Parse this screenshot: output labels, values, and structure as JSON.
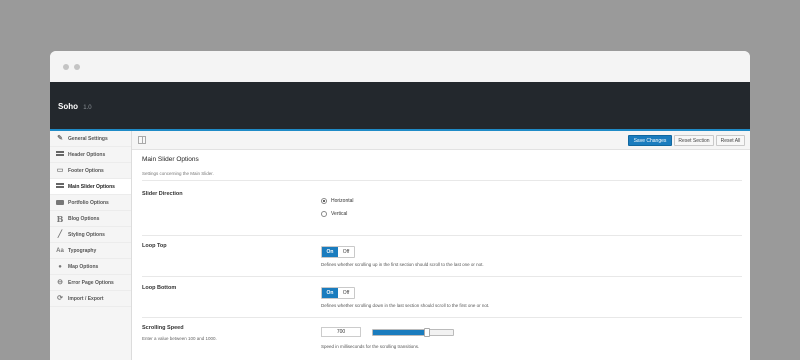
{
  "app": {
    "title": "Soho",
    "version": "1.0"
  },
  "sidebar": {
    "items": [
      {
        "label": "General Settings",
        "icon": "wrench-icon"
      },
      {
        "label": "Header Options",
        "icon": "header-icon"
      },
      {
        "label": "Footer Options",
        "icon": "footer-icon"
      },
      {
        "label": "Main Slider Options",
        "icon": "slider-icon",
        "active": true
      },
      {
        "label": "Portfolio Options",
        "icon": "folder-icon"
      },
      {
        "label": "Blog Options",
        "icon": "bold-b-icon"
      },
      {
        "label": "Styling Options",
        "icon": "pencil-icon"
      },
      {
        "label": "Typography",
        "icon": "typography-icon"
      },
      {
        "label": "Map Options",
        "icon": "map-pin-icon"
      },
      {
        "label": "Error Page Options",
        "icon": "error-icon"
      },
      {
        "label": "Import / Export",
        "icon": "refresh-icon"
      }
    ]
  },
  "toolbar": {
    "save_label": "Save Changes",
    "reset_section_label": "Reset Section",
    "reset_all_label": "Reset All"
  },
  "section": {
    "title": "Main Slider Options",
    "description": "Settings concerning the Main Slider."
  },
  "fields": {
    "slider_direction": {
      "label": "Slider Direction",
      "options": [
        "Horizontal",
        "Vertical"
      ],
      "selected": "Horizontal"
    },
    "loop_top": {
      "label": "Loop Top",
      "on_label": "On",
      "off_label": "Off",
      "value": "On",
      "description": "Defines whether scrolling up in the first section should scroll to the last one or not."
    },
    "loop_bottom": {
      "label": "Loop Bottom",
      "on_label": "On",
      "off_label": "Off",
      "value": "On",
      "description": "Defines whether scrolling down in the last section should scroll to the first one or not."
    },
    "scrolling_speed": {
      "label": "Scrolling Speed",
      "sublabel": "Enter a value between 100 and 1000.",
      "value": "700",
      "slider_fraction": 0.67,
      "description": "Speed in milliseconds for the scrolling transitions."
    }
  },
  "colors": {
    "accent": "#1a7cbe",
    "header_bg": "#23282d",
    "header_underline": "#1f8bc7"
  }
}
